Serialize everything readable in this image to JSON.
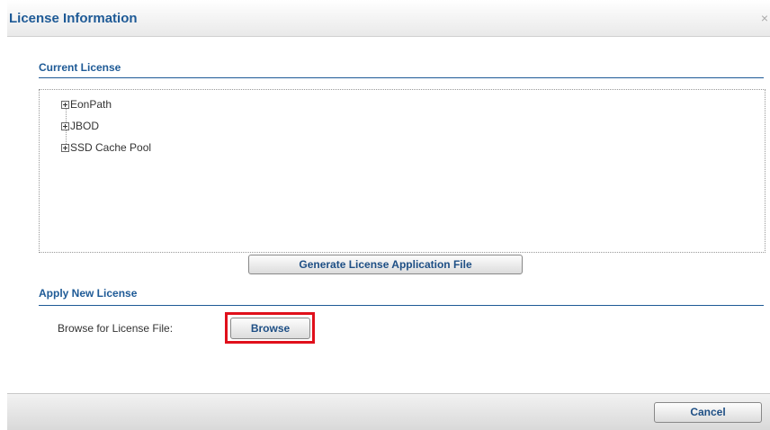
{
  "dialog": {
    "title": "License Information",
    "close_symbol": "×",
    "close_icon": "close-icon"
  },
  "current_license": {
    "heading": "Current License",
    "tree": [
      {
        "label": "EonPath",
        "icon": "plus-expander-icon"
      },
      {
        "label": "JBOD",
        "icon": "plus-expander-icon"
      },
      {
        "label": "SSD Cache Pool",
        "icon": "plus-expander-icon"
      }
    ],
    "generate_button": "Generate License Application File"
  },
  "apply_license": {
    "heading": "Apply New License",
    "browse_label": "Browse for License File:",
    "browse_button": "Browse"
  },
  "footer": {
    "cancel_button": "Cancel"
  },
  "colors": {
    "heading": "#1e5a96",
    "highlight": "#e0101b"
  }
}
